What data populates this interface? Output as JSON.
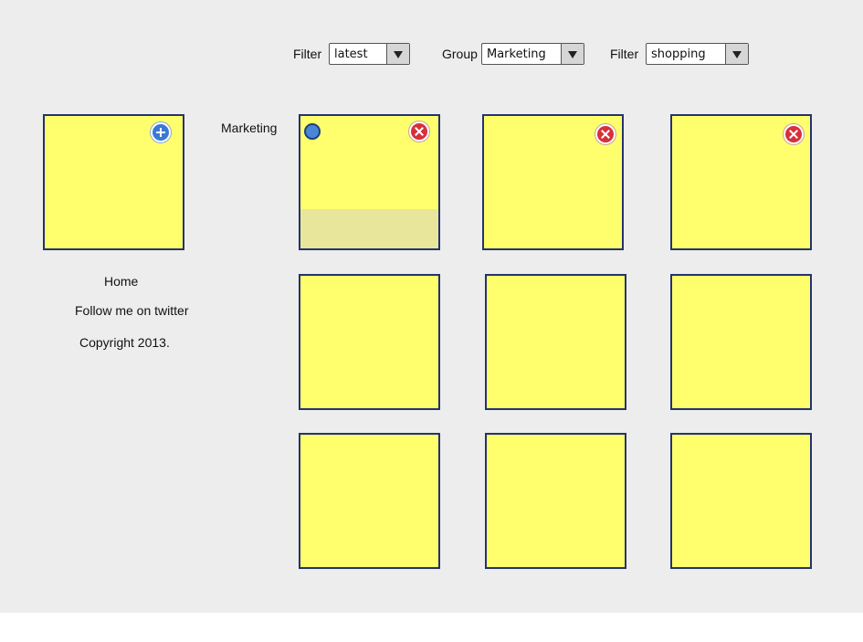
{
  "toolbar": {
    "filter1_label": "Filter",
    "filter1_value": "latest",
    "group_label": "Group",
    "group_value": "Marketing",
    "filter2_label": "Filter",
    "filter2_value": "shopping"
  },
  "sidebar": {
    "home": "Home",
    "twitter": "Follow me on twitter",
    "copyright": "Copyright 2013."
  },
  "group_heading": "Marketing",
  "colors": {
    "note_fill": "#ffff6e",
    "note_border": "#24336e",
    "background": "#ededed"
  },
  "icons": {
    "add": "add-icon",
    "close": "close-icon",
    "select": "radio-dot-icon"
  }
}
